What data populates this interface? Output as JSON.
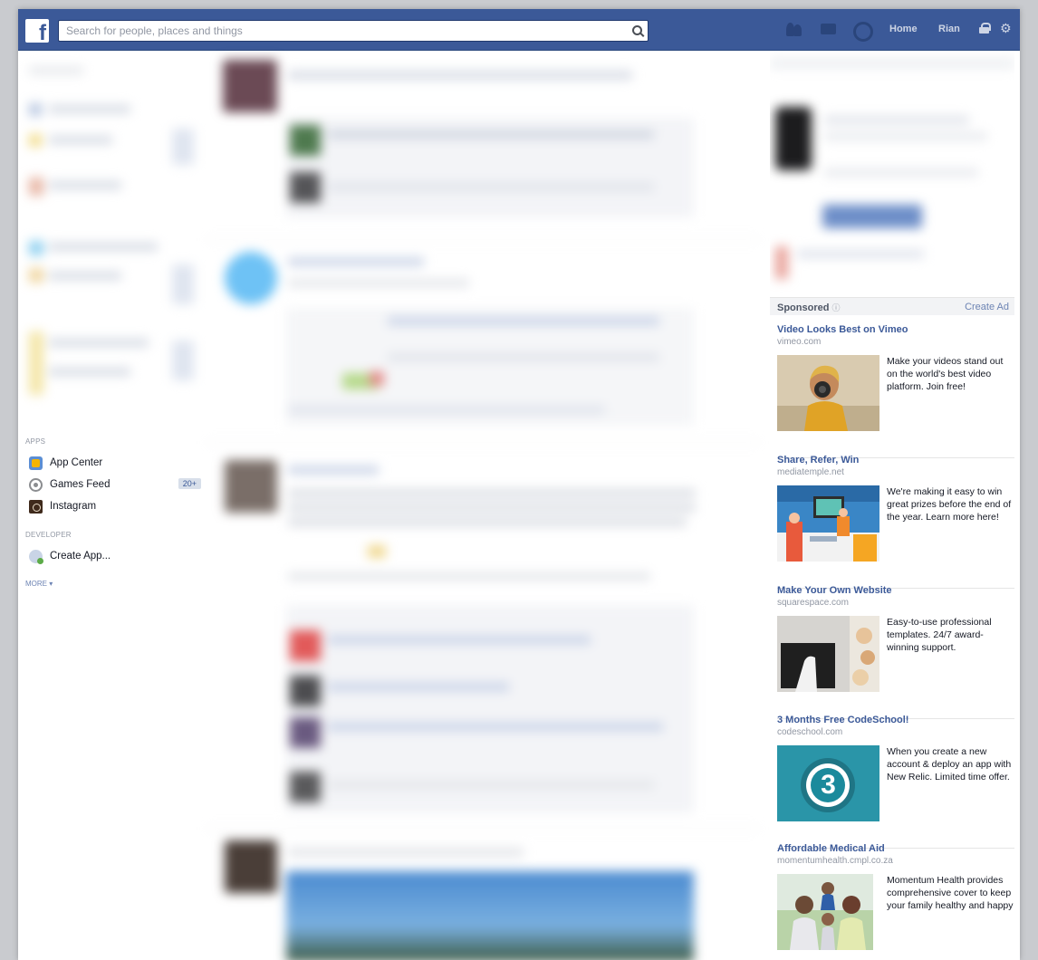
{
  "topbar": {
    "logo_letter": "f",
    "search_placeholder": "Search for people, places and things",
    "nav_home": "Home",
    "nav_user": "Rian",
    "icons": [
      "friends-icon",
      "messages-icon",
      "notifications-icon",
      "privacy-lock-icon",
      "gear-icon"
    ],
    "brand_color": "#3b5998"
  },
  "sidebar": {
    "apps_label": "APPS",
    "apps": [
      {
        "label": "App Center",
        "icon": "app-center-icon"
      },
      {
        "label": "Games Feed",
        "icon": "games-feed-icon",
        "count": "20+"
      },
      {
        "label": "Instagram",
        "icon": "instagram-icon"
      }
    ],
    "developer_label": "DEVELOPER",
    "developer": [
      {
        "label": "Create App...",
        "icon": "create-app-icon"
      }
    ],
    "more_label": "MORE ▾"
  },
  "sponsored": {
    "title": "Sponsored",
    "create_ad": "Create Ad",
    "ads": [
      {
        "title": "Video Looks Best on Vimeo",
        "domain": "vimeo.com",
        "body": "Make your videos stand out on the world's best video platform. Join free!"
      },
      {
        "title": "Share, Refer, Win",
        "domain": "mediatemple.net",
        "body": "We're making it easy to win great prizes before the end of the year. Learn more here!"
      },
      {
        "title": "Make Your Own Website",
        "domain": "squarespace.com",
        "body": "Easy-to-use professional templates. 24/7 award-winning support."
      },
      {
        "title": "3 Months Free CodeSchool!",
        "domain": "codeschool.com",
        "body": "When you create a new account & deploy an app with New Relic. Limited time offer.",
        "image_text": "3"
      },
      {
        "title": "Affordable Medical Aid",
        "domain": "momentumhealth.cmpl.co.za",
        "body": "Momentum Health provides comprehensive cover to keep your family healthy and happy"
      }
    ]
  }
}
